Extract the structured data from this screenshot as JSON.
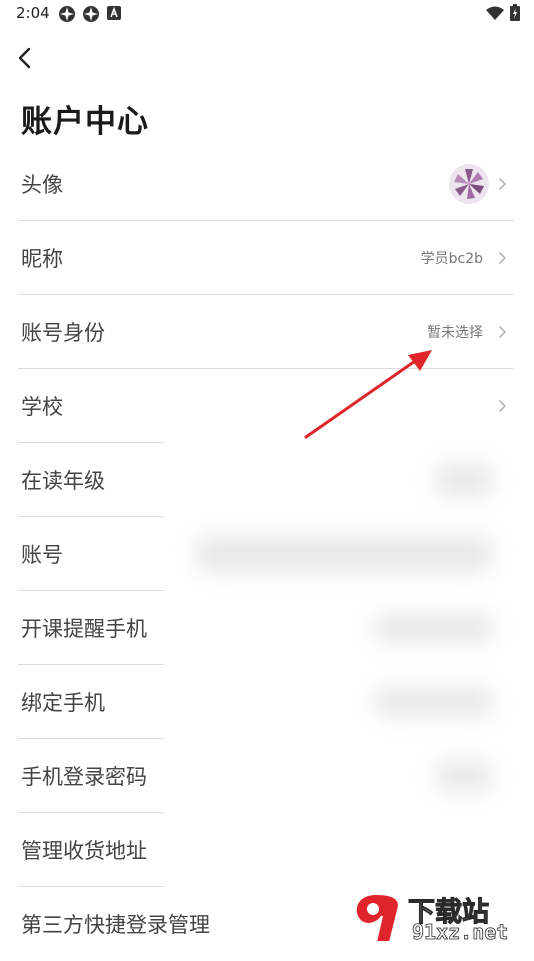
{
  "status": {
    "time": "2:04",
    "left_icons": [
      "app-icon",
      "app-icon",
      "font-icon"
    ],
    "right_icons": [
      "wifi-icon",
      "battery-icon"
    ]
  },
  "header": {
    "back_icon": "chevron-left-icon",
    "title": "账户中心"
  },
  "rows": [
    {
      "label": "头像",
      "value": "",
      "has_avatar": true,
      "has_chevron": true
    },
    {
      "label": "昵称",
      "value": "学员bc2b",
      "has_chevron": true
    },
    {
      "label": "账号身份",
      "value": "暂未选择",
      "has_chevron": true
    },
    {
      "label": "学校",
      "value": "",
      "has_chevron": true
    },
    {
      "label": "在读年级",
      "value": ""
    },
    {
      "label": "账号",
      "value": ""
    },
    {
      "label": "开课提醒手机",
      "value": ""
    },
    {
      "label": "绑定手机",
      "value": ""
    },
    {
      "label": "手机登录密码",
      "value": ""
    },
    {
      "label": "管理收货地址",
      "value": ""
    },
    {
      "label": "第三方快捷登录管理",
      "value": ""
    }
  ],
  "annotation": {
    "arrow_color": "#e0242b"
  },
  "watermark": {
    "brand_top": "下载站",
    "brand_bottom": "91xz.net",
    "accent": "#e0242b"
  }
}
